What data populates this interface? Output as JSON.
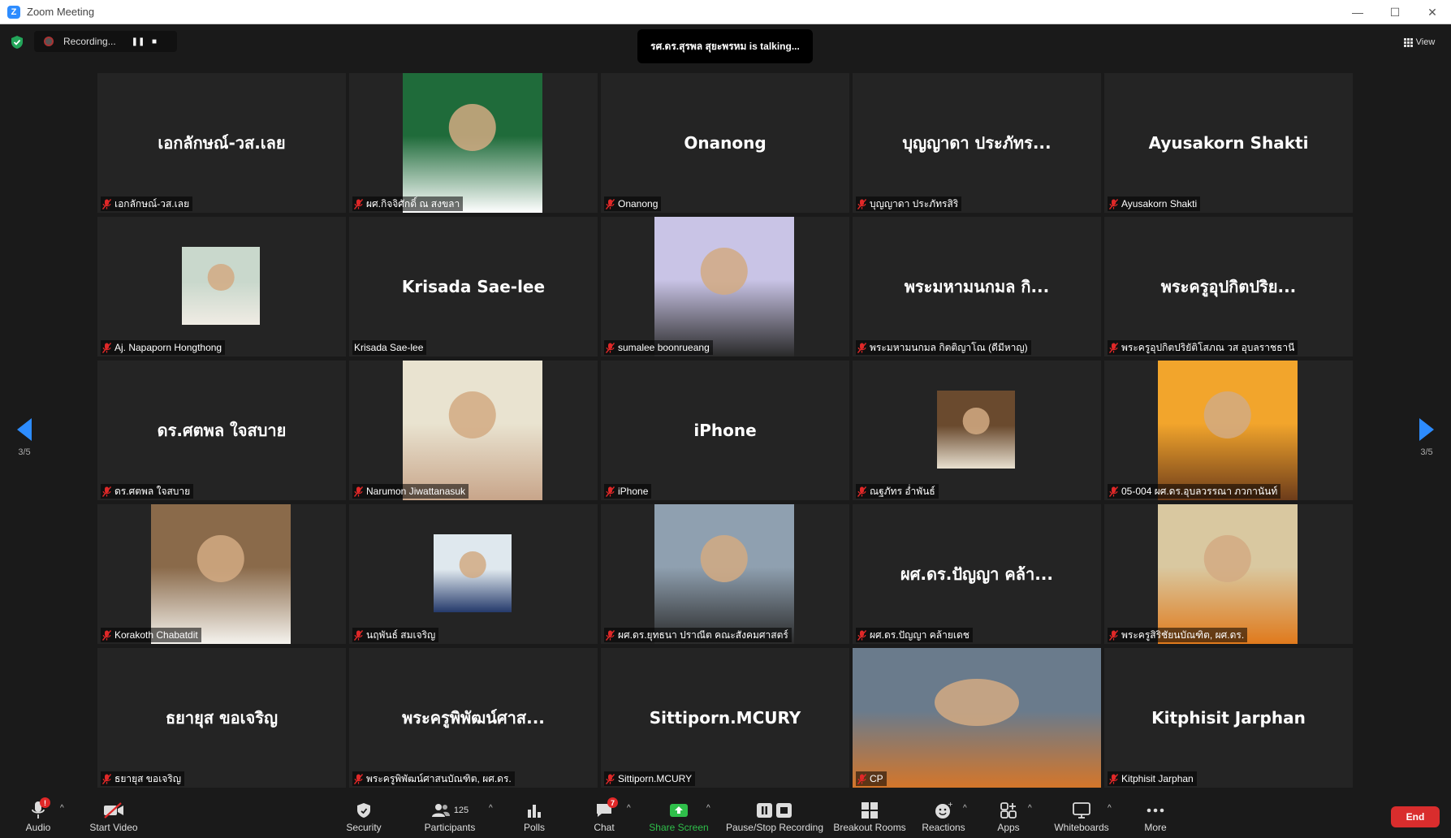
{
  "window": {
    "title": "Zoom Meeting",
    "logo_letter": "Z"
  },
  "meeting_bar": {
    "recording_label": "Recording...",
    "talking_text": "รศ.ดร.สุรพล สุยะพรหม is talking...",
    "view_label": "View"
  },
  "navigation": {
    "page_left": "3/5",
    "page_right": "3/5"
  },
  "tiles": [
    {
      "display": "เอกลักษณ์-วส.เลย",
      "label": "เอกลักษณ์-วส.เลย",
      "muted": true
    },
    {
      "display": "",
      "label": "ผศ.กิจจิศักดิ์ ณ สงขลา",
      "muted": true
    },
    {
      "display": "Onanong",
      "label": "Onanong",
      "muted": true
    },
    {
      "display": "บุญญาดา ประภัทร...",
      "label": "บุญญาดา ประภัทรสิริ",
      "muted": true
    },
    {
      "display": "Ayusakorn Shakti",
      "label": "Ayusakorn Shakti",
      "muted": true
    },
    {
      "display": "",
      "label": "Aj. Napaporn Hongthong",
      "muted": true
    },
    {
      "display": "Krisada Sae-lee",
      "label": "Krisada Sae-lee",
      "muted": false
    },
    {
      "display": "",
      "label": "sumalee boonrueang",
      "muted": true
    },
    {
      "display": "พระมหามนกมล กิ...",
      "label": "พระมหามนกมล กิตติญาโณ (ดีมีหาญ)",
      "muted": true
    },
    {
      "display": "พระครูอุปกิตปริย...",
      "label": "พระครูอุปกิตปริยัติโสภณ วส อุบลราชธานี",
      "muted": true
    },
    {
      "display": "ดร.ศตพล ใจสบาย",
      "label": "ดร.ศตพล ใจสบาย",
      "muted": true
    },
    {
      "display": "",
      "label": "Narumon Jiwattanasuk",
      "muted": true
    },
    {
      "display": "iPhone",
      "label": "iPhone",
      "muted": true
    },
    {
      "display": "",
      "label": "ณฐภัทร อ่ำพันธ์",
      "muted": true
    },
    {
      "display": "",
      "label": "05-004 ผศ.ดร.อุบลวรรณา ภวกานันท์",
      "muted": true
    },
    {
      "display": "",
      "label": "Korakoth Chabatdit",
      "muted": true
    },
    {
      "display": "",
      "label": "นฤพันธ์ สมเจริญ",
      "muted": true
    },
    {
      "display": "",
      "label": "ผศ.ดร.ยุทธนา ปราณีต คณะสังคมศาสตร์",
      "muted": true
    },
    {
      "display": "ผศ.ดร.ปัญญา คล้า...",
      "label": "ผศ.ดร.ปัญญา คล้ายเดช",
      "muted": true
    },
    {
      "display": "",
      "label": "พระครูสิริชัยนบัณฑิต, ผศ.ดร.",
      "muted": true
    },
    {
      "display": "ธยายุส ขอเจริญ",
      "label": "ธยายุส ขอเจริญ",
      "muted": true
    },
    {
      "display": "พระครูพิพัฒน์ศาส...",
      "label": "พระครูพิพัฒน์ศาสนบัณฑิต, ผศ.ดร.",
      "muted": true
    },
    {
      "display": "Sittiporn.MCURY",
      "label": "Sittiporn.MCURY",
      "muted": true
    },
    {
      "display": "",
      "label": "CP",
      "muted": true
    },
    {
      "display": "Kitphisit Jarphan",
      "label": "Kitphisit Jarphan",
      "muted": true
    }
  ],
  "toolbar": {
    "audio": "Audio",
    "audio_badge": "!",
    "start_video": "Start Video",
    "security": "Security",
    "participants": "Participants",
    "participants_count": "125",
    "polls": "Polls",
    "chat": "Chat",
    "chat_badge": "7",
    "share_screen": "Share Screen",
    "pause_stop_recording": "Pause/Stop Recording",
    "breakout_rooms": "Breakout Rooms",
    "reactions": "Reactions",
    "apps": "Apps",
    "whiteboards": "Whiteboards",
    "more": "More",
    "end": "End"
  },
  "colors": {
    "accent": "#2d8cff",
    "end": "#d92d2d",
    "share": "#2fbf4a",
    "muted_mic": "#e02828"
  }
}
